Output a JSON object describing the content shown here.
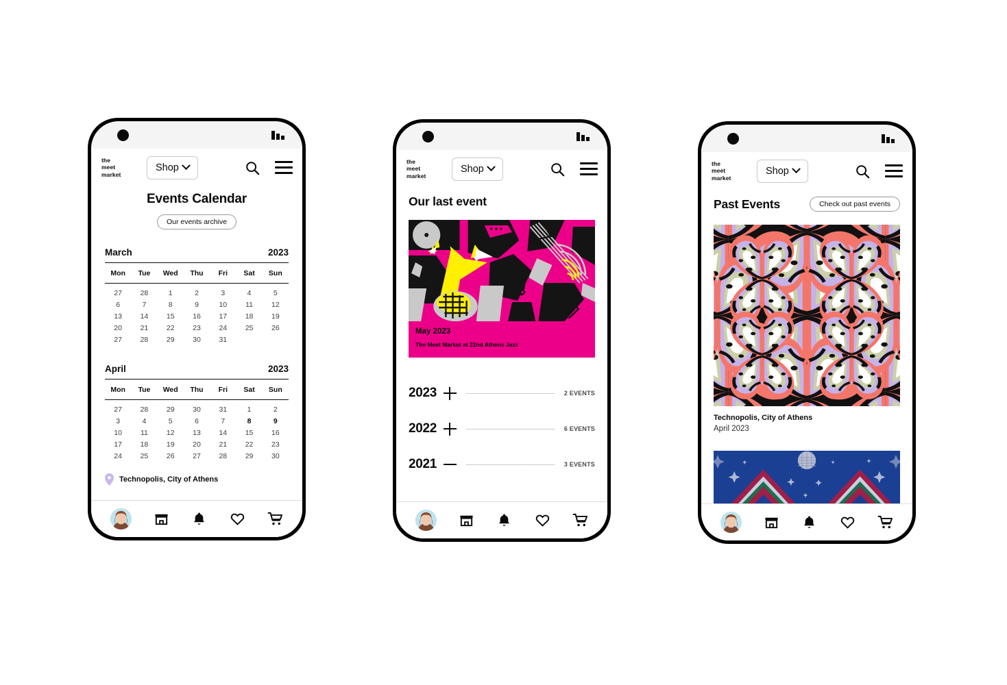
{
  "brand": {
    "logo_text": "the\nmeet\nmarket",
    "accent_magenta": "#ec0089",
    "accent_purple": "#c9b6ea",
    "blue": "#1b3f93"
  },
  "header": {
    "shop_label": "Shop",
    "search_icon": "search-icon",
    "menu_icon": "hamburger-menu-icon",
    "chevron_icon": "chevron-down-icon"
  },
  "bottom_nav": {
    "items": [
      {
        "name": "profile-avatar",
        "icon": "avatar-photo"
      },
      {
        "name": "shop",
        "icon": "storefront-icon"
      },
      {
        "name": "notifications",
        "icon": "bell-icon"
      },
      {
        "name": "favorites",
        "icon": "heart-icon"
      },
      {
        "name": "cart",
        "icon": "shopping-cart-icon"
      }
    ]
  },
  "screen1": {
    "title": "Events Calendar",
    "archive_button": "Our events archive",
    "weekdays": [
      "Mon",
      "Tue",
      "Wed",
      "Thu",
      "Fri",
      "Sat",
      "Sun"
    ],
    "months": [
      {
        "name": "March",
        "year": "2023",
        "days": [
          "27",
          "28",
          "1",
          "2",
          "3",
          "4",
          "5",
          "6",
          "7",
          "8",
          "9",
          "10",
          "11",
          "12",
          "13",
          "14",
          "15",
          "16",
          "17",
          "18",
          "19",
          "20",
          "21",
          "22",
          "23",
          "24",
          "25",
          "26",
          "27",
          "28",
          "29",
          "30",
          "31",
          "",
          ""
        ],
        "highlighted": []
      },
      {
        "name": "April",
        "year": "2023",
        "days": [
          "27",
          "28",
          "29",
          "30",
          "31",
          "1",
          "2",
          "3",
          "4",
          "5",
          "6",
          "7",
          "8",
          "9",
          "10",
          "11",
          "12",
          "13",
          "14",
          "15",
          "16",
          "17",
          "18",
          "19",
          "20",
          "21",
          "22",
          "23",
          "24",
          "25",
          "26",
          "27",
          "28",
          "29",
          "30"
        ],
        "highlighted": [
          12,
          13
        ]
      }
    ],
    "venue": "Technopolis, City of Athens",
    "venue_icon": "map-pin-icon"
  },
  "screen2": {
    "title": "Our last event",
    "poster": {
      "date": "May 2023",
      "caption": "The Meet Market at 22nd Athens Jazz",
      "art_name": "jazz-collage-artwork"
    },
    "years": [
      {
        "year": "2023",
        "sign": "plus",
        "count": "2 EVENTS"
      },
      {
        "year": "2022",
        "sign": "plus",
        "count": "6 EVENTS"
      },
      {
        "year": "2021",
        "sign": "minus",
        "count": "3 EVENTS"
      }
    ]
  },
  "screen3": {
    "title": "Past Events",
    "cta": "Check out past events",
    "entries": [
      {
        "art_name": "butterfly-kaleidoscope-artwork",
        "venue": "Technopolis, City of Athens",
        "date": "April 2023"
      },
      {
        "art_name": "blue-chevron-disco-artwork"
      }
    ]
  }
}
